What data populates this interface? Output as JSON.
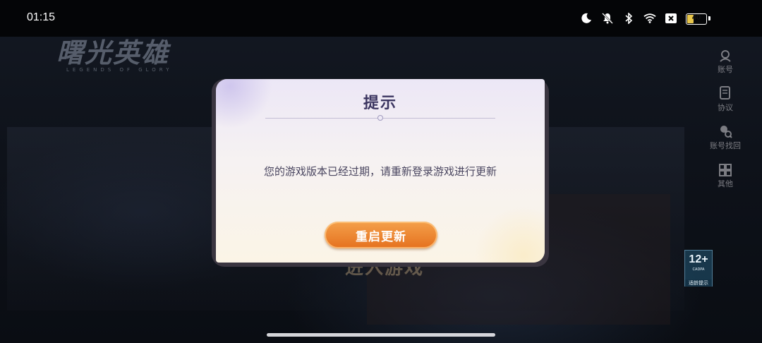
{
  "status_bar": {
    "time": "01:15",
    "battery_level": "40",
    "battery_fraction": 0.4,
    "icons": [
      "moon-icon",
      "bell-off-icon",
      "bluetooth-icon",
      "wifi-icon",
      "close-box-icon",
      "battery-icon"
    ]
  },
  "game": {
    "logo_cn": "曙光英雄",
    "logo_en": "LEGENDS OF GLORY",
    "enter_game_label": "进入游戏",
    "age_rating": "12+",
    "age_rating_sub": "CADPA",
    "age_rating_label": "适龄提示"
  },
  "side_menu": {
    "items": [
      {
        "label": "账号",
        "icon": "account-icon"
      },
      {
        "label": "协议",
        "icon": "agreement-icon"
      },
      {
        "label": "账号找回",
        "icon": "account-recover-icon"
      },
      {
        "label": "其他",
        "icon": "more-grid-icon"
      }
    ]
  },
  "dialog": {
    "title": "提示",
    "message": "您的游戏版本已经过期，请重新登录游戏进行更新",
    "button_label": "重启更新"
  },
  "colors": {
    "accent_button": "#e5711e",
    "dialog_title": "#3b3560",
    "battery": "#e8c64a"
  }
}
